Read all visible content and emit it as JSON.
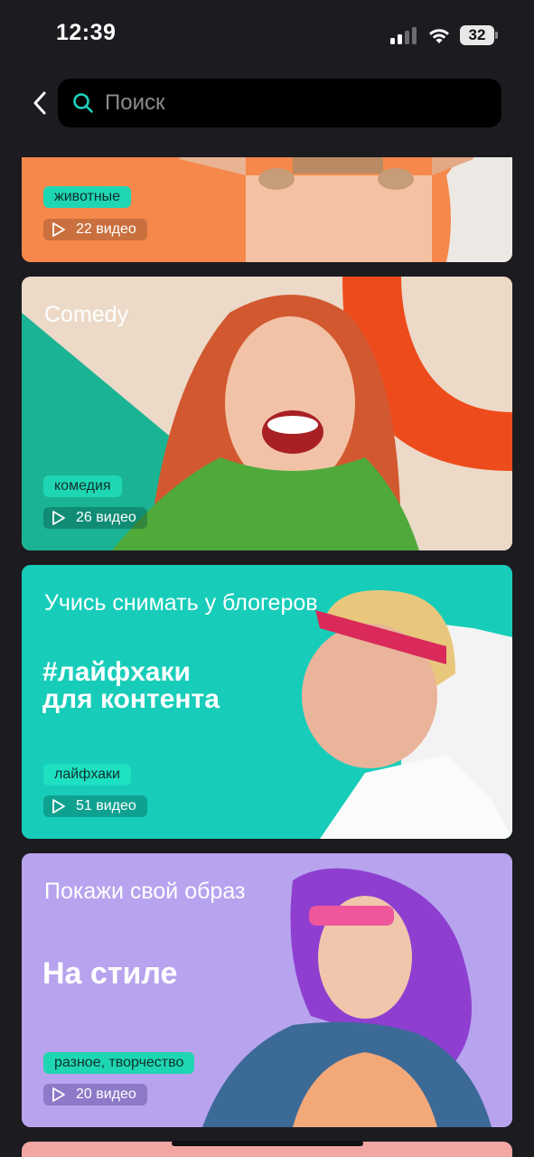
{
  "status_bar": {
    "time": "12:39",
    "battery": "32",
    "icons": [
      "signal-icon",
      "wifi-icon",
      "battery-icon"
    ]
  },
  "header": {
    "back_icon": "chevron-left-icon",
    "search_icon": "search-icon",
    "search_placeholder": "Поиск",
    "search_value": ""
  },
  "colors": {
    "background": "#1c1b20",
    "search_accent": "#1dd3bf",
    "tag_green": "#1fd6b3"
  },
  "categories": [
    {
      "title": "",
      "tag": "животные",
      "video_count": "22 видео",
      "play_icon": "play-icon"
    },
    {
      "title": "Comedy",
      "tag": "комедия",
      "video_count": "26 видео",
      "play_icon": "play-icon"
    },
    {
      "title": "Учись снимать у блогеров",
      "headline_line1": "#лайфхаки",
      "headline_line2": "для контента",
      "tag": "лайфхаки",
      "video_count": "51 видео",
      "play_icon": "play-icon"
    },
    {
      "title": "Покажи свой образ",
      "headline_line1": "На стиле",
      "tag": "разное, творчество",
      "video_count": "20 видео",
      "play_icon": "play-icon"
    }
  ]
}
